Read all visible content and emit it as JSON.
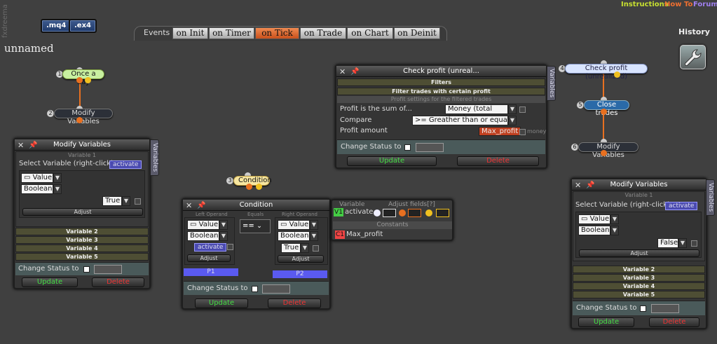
{
  "brand": "fxdreema",
  "top_links": {
    "instructions": "Instructions",
    "howto": "How To",
    "forum": "Forum"
  },
  "ext_buttons": {
    "mq4": ".mq4",
    "ex4": ".ex4"
  },
  "events": {
    "label": "Events",
    "tabs": [
      "on Init",
      "on Timer",
      "on Tick",
      "on Trade",
      "on Chart",
      "on Deinit"
    ],
    "active": "on Tick"
  },
  "project_title": "unnamed",
  "history": "History",
  "nodes": {
    "n1": {
      "num": "1",
      "label": "Once a day"
    },
    "n2": {
      "num": "2",
      "label": "Modify Variables"
    },
    "n3": {
      "num": "3",
      "label": "Condition"
    },
    "n4": {
      "num": "4",
      "label": "Check profit (unrealized)"
    },
    "n5": {
      "num": "5",
      "label": "Close trades"
    },
    "n6": {
      "num": "6",
      "label": "Modify Variables"
    }
  },
  "mv1": {
    "title": "Modify Variables",
    "var_header": "Variable 1",
    "select_label": "Select Variable (right-click)",
    "badge": "activate",
    "type1": "Value",
    "type2": "Boolean",
    "value": "True",
    "adjust": "Adjust",
    "vars": [
      "Variable 2",
      "Variable 3",
      "Variable 4",
      "Variable 5"
    ],
    "change_status": "Change Status to",
    "update": "Update",
    "delete": "Delete",
    "side": "Variables"
  },
  "cond": {
    "title": "Condition",
    "left": "Left Operand",
    "equals": "Equals",
    "right": "Right Operand",
    "l_type1": "Value",
    "l_type2": "Boolean",
    "l_badge": "activate",
    "l_adjust": "Adjust",
    "op": "==",
    "r_type1": "Value",
    "r_type2": "Boolean",
    "r_val": "True",
    "r_adjust": "Adjust",
    "p1": "P1",
    "p2": "P2",
    "change_status": "Change Status to",
    "update": "Update",
    "delete": "Delete"
  },
  "varpanel": {
    "variable": "Variable",
    "adjust": "Adjust fields[?]",
    "v1": "V1",
    "v1name": "activate",
    "constants": "Constants",
    "c1": "C1",
    "c1name": "Max_profit"
  },
  "cp": {
    "title": "Check profit (unreal...",
    "filters": "Filters",
    "filter_trades": "Filter trades with certain profit",
    "profit_settings": "Profit settings for the filtered trades",
    "row1": "Profit is the sum of...",
    "row1val": "Money (total sum)",
    "row2": "Compare",
    "row2val": ">= Greather than or equal to",
    "row3": "Profit amount",
    "row3val": "Max_profit",
    "money": "money",
    "change_status": "Change Status to",
    "update": "Update",
    "delete": "Delete",
    "side": "Variables"
  },
  "mv2": {
    "title": "Modify Variables",
    "var_header": "Variable 1",
    "select_label": "Select Variable (right-click)",
    "badge": "activate",
    "type1": "Value",
    "type2": "Boolean",
    "value": "False",
    "adjust": "Adjust",
    "vars": [
      "Variable 2",
      "Variable 3",
      "Variable 4",
      "Variable 5"
    ],
    "change_status": "Change Status to",
    "update": "Update",
    "delete": "Delete",
    "side": "Variables"
  },
  "colors": {
    "accent": "#e87020",
    "tab_active": "#e0703a",
    "update": "#44dd44",
    "delete": "#ee3333"
  }
}
